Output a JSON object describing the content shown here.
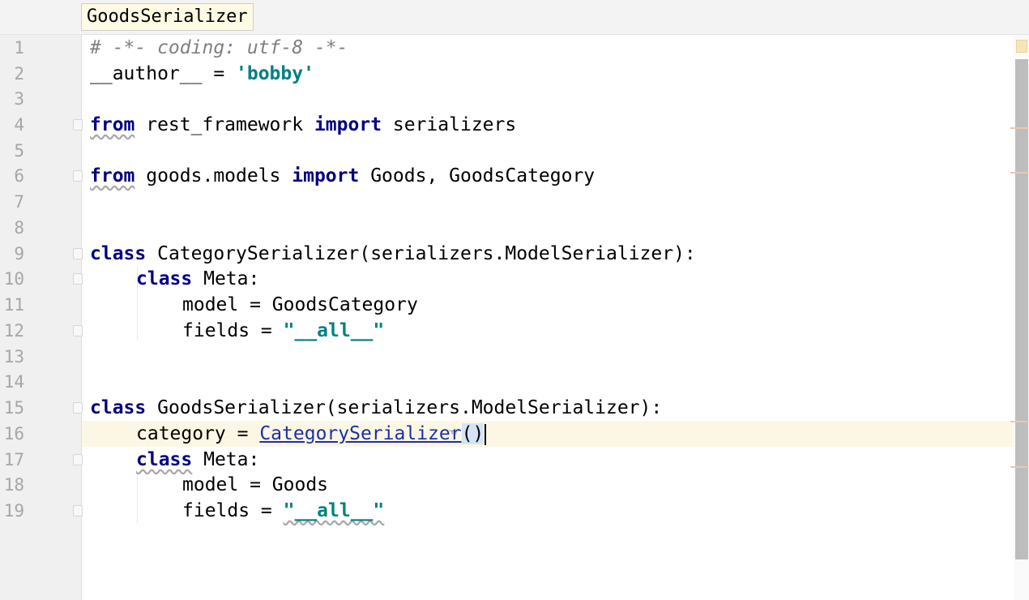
{
  "breadcrumb": {
    "label": "GoodsSerializer"
  },
  "line_numbers": [
    "1",
    "2",
    "3",
    "4",
    "5",
    "6",
    "7",
    "8",
    "9",
    "10",
    "11",
    "12",
    "13",
    "14",
    "15",
    "16",
    "17",
    "18",
    "19"
  ],
  "code": {
    "l1_comment": "# -*- coding: utf-8 -*-",
    "l2_name": "__author__ = ",
    "l2_string": "'bobby'",
    "kw_from": "from",
    "kw_import": "import",
    "kw_class": "class",
    "l4_module": " rest_framework ",
    "l4_target": " serializers",
    "l6_module": " goods.models ",
    "l6_target": " Goods, GoodsCategory",
    "l9_rest": " CategorySerializer(serializers.ModelSerializer):",
    "l10_rest": " Meta:",
    "l11": "model = GoodsCategory",
    "fields_lhs": "fields = ",
    "all_string": "\"__all__\"",
    "l15_rest": " GoodsSerializer(serializers.ModelSerializer):",
    "l16_lhs": "category = ",
    "l16_ref": "CategorySerializer",
    "l16_parens": "()",
    "l17_rest": " Meta:",
    "l18": "model = Goods"
  },
  "editor": {
    "caret_line": 16
  },
  "colors": {
    "keyword": "#000080",
    "string": "#008080",
    "comment": "#808080",
    "caret_row": "#fcf7e4",
    "reference": "#1c2fa8"
  }
}
